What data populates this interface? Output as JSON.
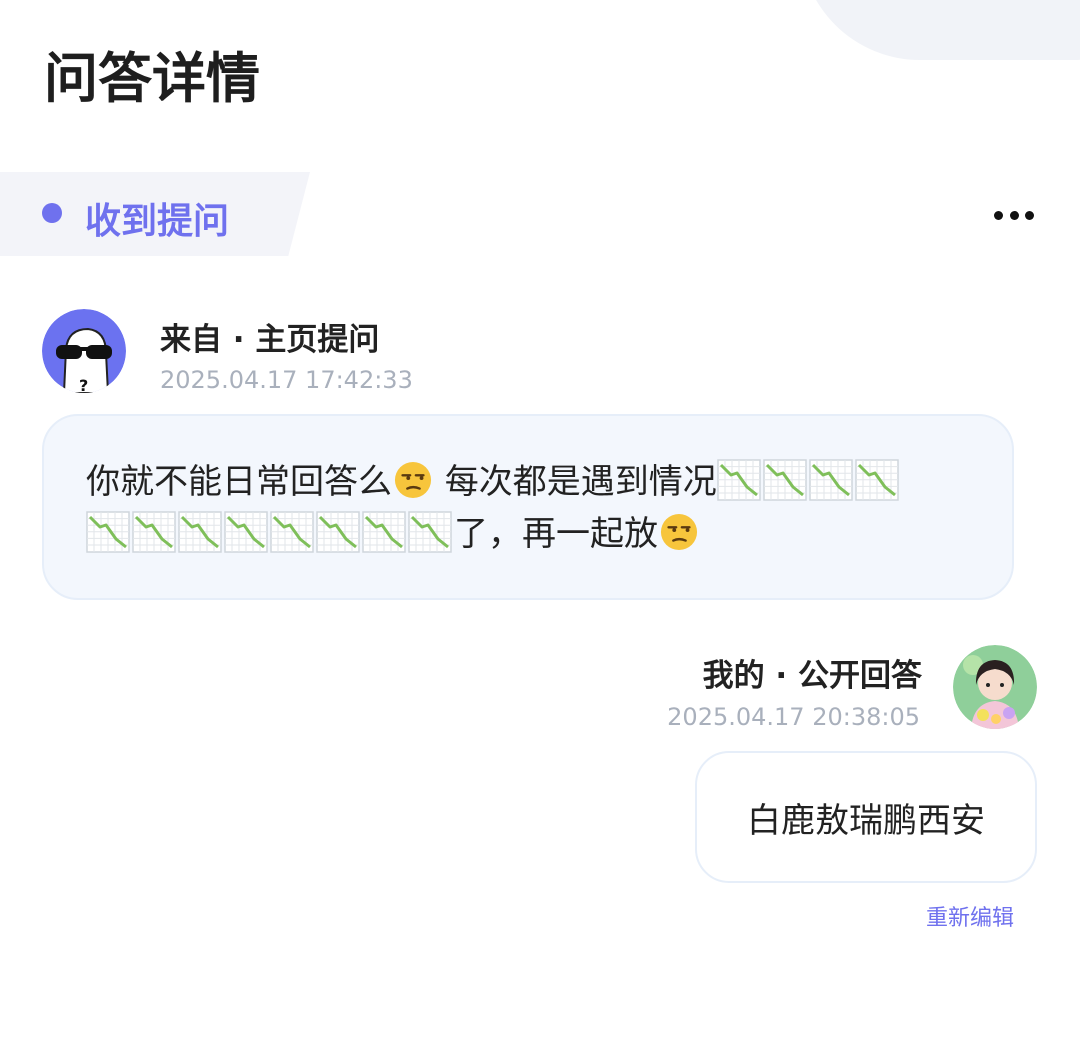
{
  "header": {
    "title": "问答详情"
  },
  "section": {
    "label": "收到提问",
    "accent_color": "#6f71ee",
    "more_icon": "more-horizontal-icon"
  },
  "question": {
    "avatar_icon": "anonymous-sunglasses-avatar",
    "source": "来自 · 主页提问",
    "time": "2025.04.17 17:42:33",
    "text_1": "你就不能日常回答么",
    "text_2": " 每次都是遇到情况",
    "text_3": "了，再一起放",
    "down_chart_emoji_count": 12,
    "face_emoji": "unamused-face-emoji"
  },
  "answer": {
    "source": "我的 · 公开回答",
    "time": "2025.04.17 20:38:05",
    "text": "白鹿敖瑞鹏西安",
    "reedit_label": "重新编辑"
  }
}
